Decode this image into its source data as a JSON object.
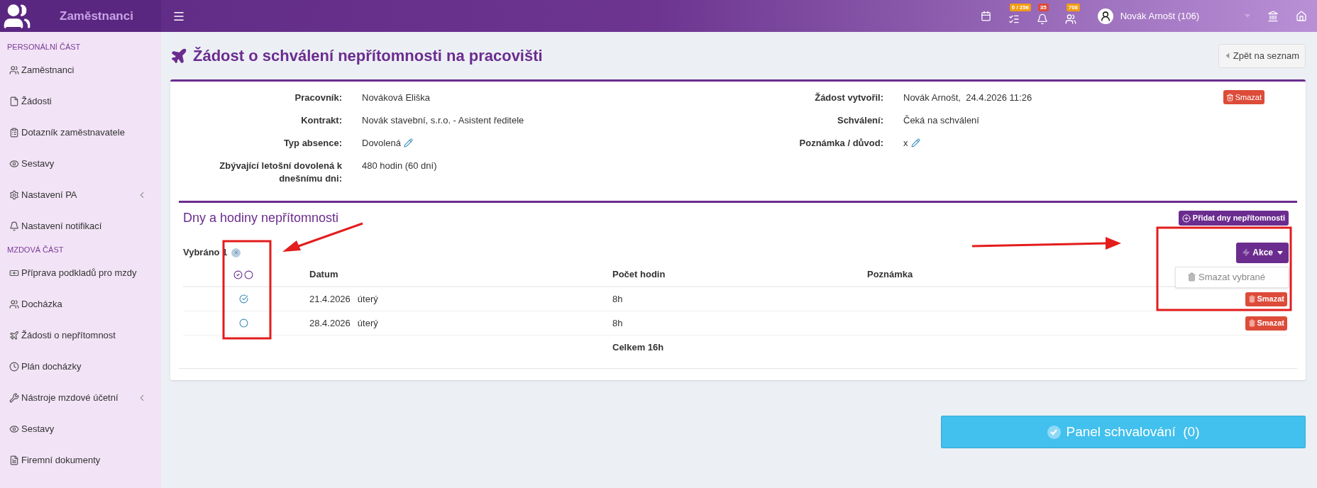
{
  "app": {
    "title": "Zaměstnanci"
  },
  "topbar": {
    "badges": [
      {
        "text": "0 / 256",
        "color": "#f39c12"
      },
      {
        "text": "35",
        "color": "#dd4b39"
      },
      {
        "text": "708",
        "color": "#f39c12"
      }
    ],
    "user": "Novák Arnošt (106)"
  },
  "sidebar": {
    "sections": [
      {
        "heading": "PERSONÁLNÍ ČÁST",
        "items": [
          {
            "label": "Zaměstnanci",
            "expandable": false
          },
          {
            "label": "Žádosti",
            "expandable": false
          },
          {
            "label": "Dotazník zaměstnavatele",
            "expandable": false
          },
          {
            "label": "Sestavy",
            "expandable": false
          },
          {
            "label": "Nastavení PA",
            "expandable": true
          },
          {
            "label": "Nastavení notifikací",
            "expandable": false
          }
        ]
      },
      {
        "heading": "MZDOVÁ ČÁST",
        "items": [
          {
            "label": "Příprava podkladů pro mzdy",
            "expandable": false
          },
          {
            "label": "Docházka",
            "expandable": false
          },
          {
            "label": "Žádosti o nepřítomnost",
            "expandable": false
          },
          {
            "label": "Plán docházky",
            "expandable": false
          },
          {
            "label": "Nástroje mzdové účetní",
            "expandable": true
          },
          {
            "label": "Sestavy",
            "expandable": false
          },
          {
            "label": "Firemní dokumenty",
            "expandable": false
          }
        ]
      }
    ]
  },
  "page": {
    "title": "Žádost o schválení nepřítomnosti na pracovišti",
    "back_button": "Zpět na seznam"
  },
  "details": {
    "delete_button": "Smazat",
    "left": [
      {
        "label": "Pracovník:",
        "value": "Nováková Eliška",
        "editable": false
      },
      {
        "label": "Kontrakt:",
        "value": "Novák stavební, s.r.o. - Asistent ředitele",
        "editable": false
      },
      {
        "label": "Typ absence:",
        "value": "Dovolená",
        "editable": true
      },
      {
        "label": "Zbývající letošní dovolená k dnešnímu dni:",
        "value": "480 hodin (60 dní)",
        "editable": false
      }
    ],
    "right": [
      {
        "label": "Žádost vytvořil:",
        "value": "Novák Arnošt,  24.4.2026 11:26",
        "editable": false
      },
      {
        "label": "Schválení:",
        "value": "Čeká na schválení",
        "editable": false
      },
      {
        "label": "Poznámka / důvod:",
        "value": "x",
        "editable": true
      }
    ]
  },
  "days": {
    "title": "Dny a hodiny nepřítomnosti",
    "add_button": "Přidat dny nepřítomnosti",
    "selected_label": "Vybráno 1",
    "actions_button": "Akce",
    "menu": [
      {
        "label": "Smazat vybrané",
        "disabled": true
      }
    ],
    "columns": [
      "Datum",
      "Počet hodin",
      "Poznámka"
    ],
    "rows": [
      {
        "date": "21.4.2026",
        "day": "úterý",
        "hours": "8h",
        "selected": true,
        "delete_button": "Smazat"
      },
      {
        "date": "28.4.2026",
        "day": "úterý",
        "hours": "8h",
        "selected": false,
        "delete_button": "Smazat"
      }
    ],
    "total": "Celkem 16h"
  },
  "approval_button": "Panel schvalování  (0)"
}
